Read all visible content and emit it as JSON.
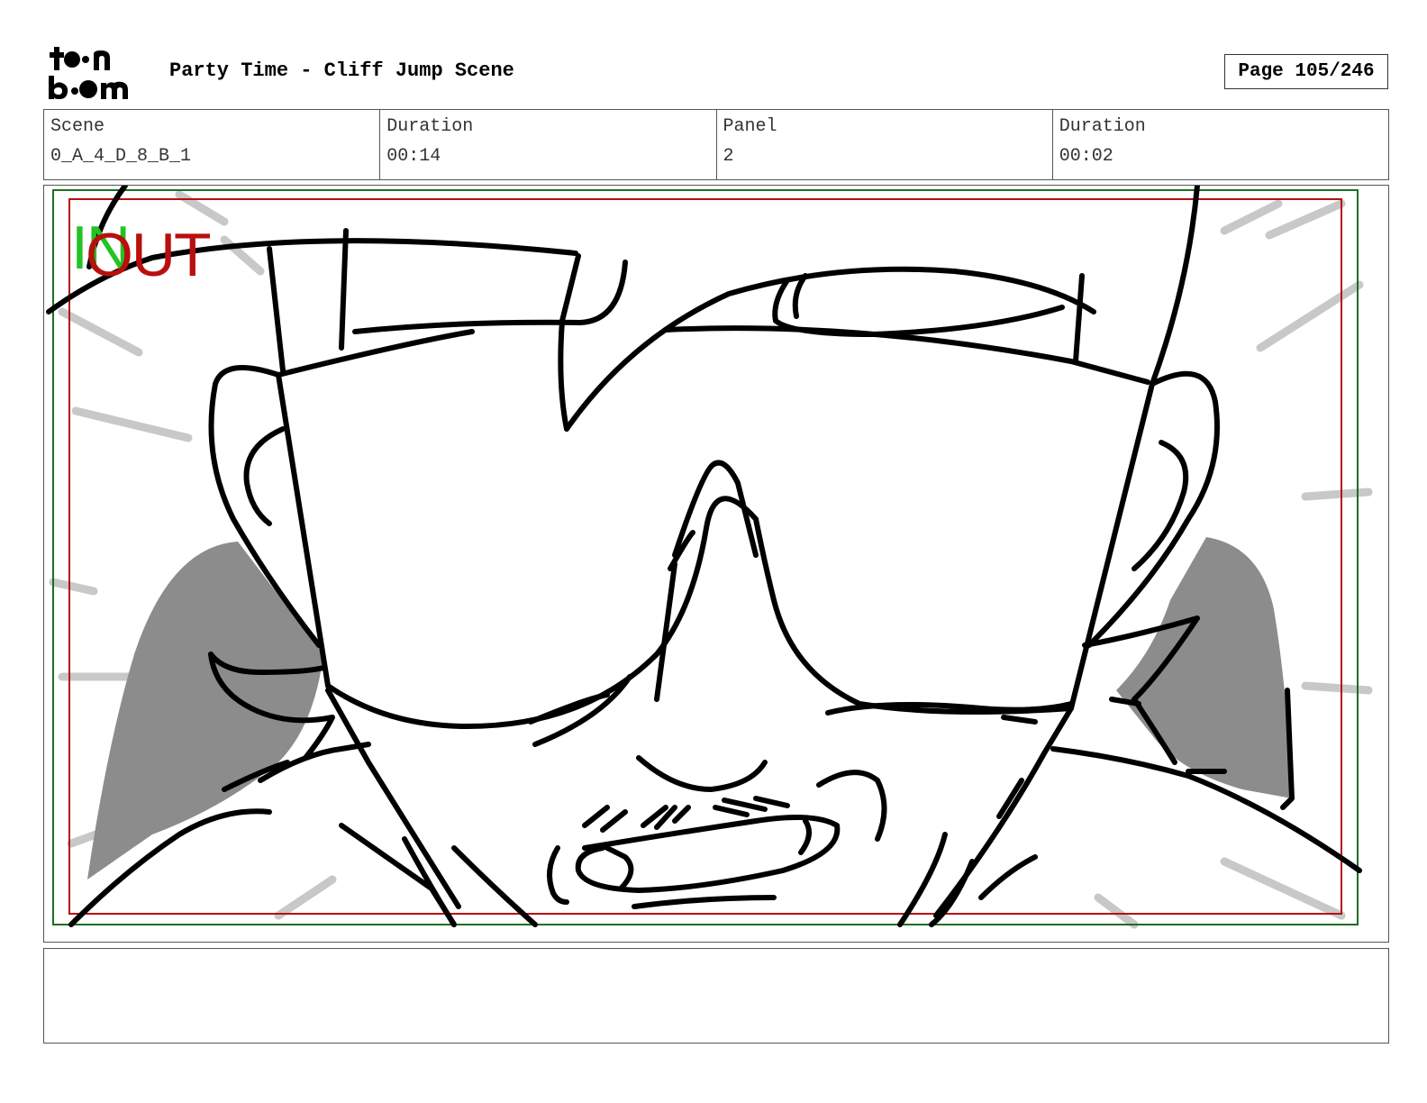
{
  "header": {
    "logo_line1": "toon",
    "logo_line2": "boom",
    "title": "Party Time - Cliff Jump Scene",
    "page_label": "Page 105/246"
  },
  "info": {
    "scene_label": "Scene",
    "scene_value": "0_A_4_D_8_B_1",
    "duration_label": "Duration",
    "duration_value": "00:14",
    "panel_label": "Panel",
    "panel_value": "2",
    "panel_duration_label": "Duration",
    "panel_duration_value": "00:02"
  },
  "panel_markers": {
    "in_label": "IN",
    "out_label": "OUT",
    "safe_frame_color": "#1f6e1f",
    "action_frame_color": "#b80f0f"
  },
  "notes": {
    "text": ""
  }
}
